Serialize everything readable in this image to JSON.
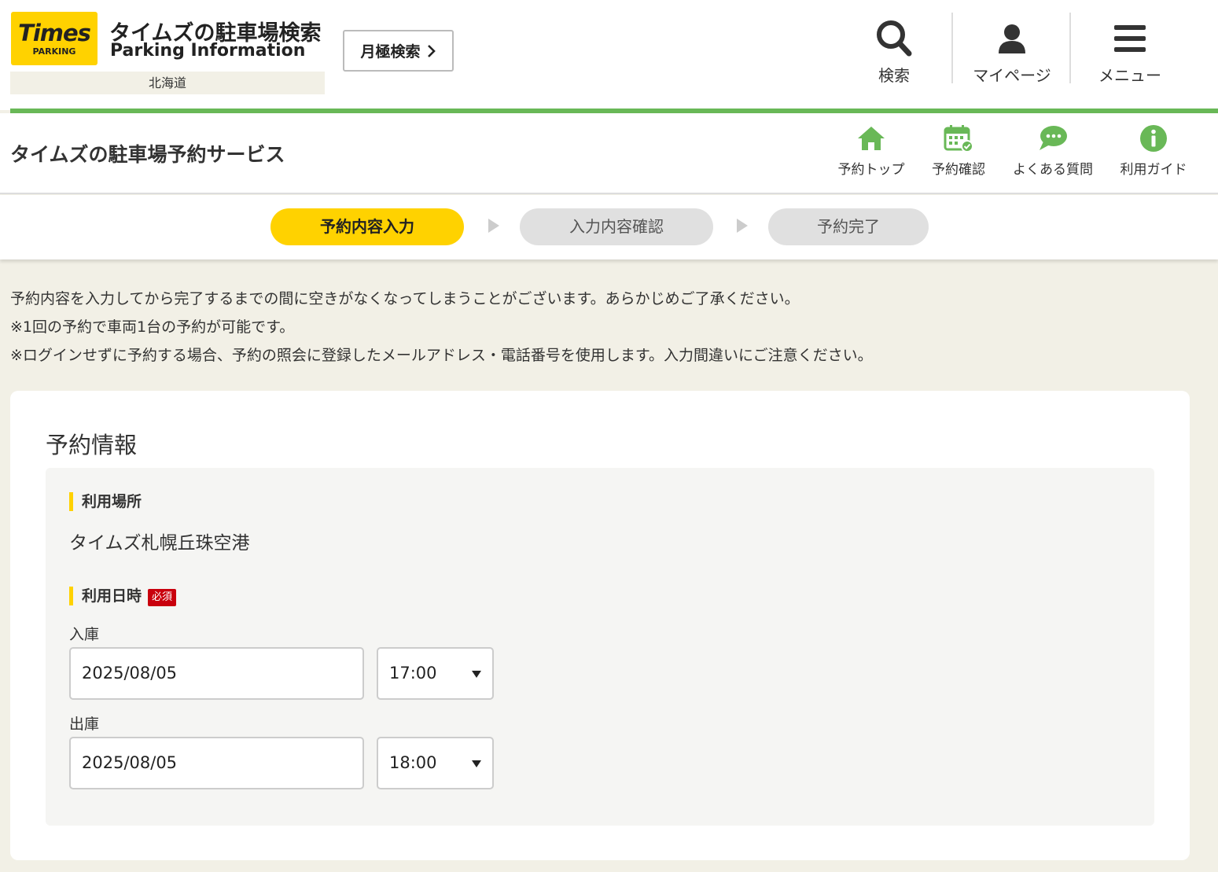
{
  "header": {
    "logo_main": "Times",
    "logo_sub": "PARKING",
    "site_title": "タイムズの駐車場検索",
    "site_subtitle": "Parking Information",
    "region": "北海道",
    "monthly_search": "月極検索",
    "nav": [
      {
        "label": "検索",
        "icon": "search-icon"
      },
      {
        "label": "マイページ",
        "icon": "user-icon"
      },
      {
        "label": "メニュー",
        "icon": "menu-icon"
      }
    ]
  },
  "service": {
    "title": "タイムズの駐車場予約サービス",
    "nav": [
      {
        "label": "予約トップ",
        "icon": "home-icon"
      },
      {
        "label": "予約確認",
        "icon": "calendar-check-icon"
      },
      {
        "label": "よくある質問",
        "icon": "chat-bubble-icon"
      },
      {
        "label": "利用ガイド",
        "icon": "info-icon"
      }
    ]
  },
  "steps": [
    {
      "label": "予約内容入力",
      "active": true
    },
    {
      "label": "入力内容確認",
      "active": false
    },
    {
      "label": "予約完了",
      "active": false
    }
  ],
  "notes": [
    "予約内容を入力してから完了するまでの間に空きがなくなってしまうことがございます。あらかじめご了承ください。",
    "※1回の予約で車両1台の予約が可能です。",
    "※ログインせずに予約する場合、予約の照会に登録したメールアドレス・電話番号を使用します。入力間違いにご注意ください。"
  ],
  "reservation": {
    "title": "予約情報",
    "place_label": "利用場所",
    "place_value": "タイムズ札幌丘珠空港",
    "datetime_label": "利用日時",
    "required_badge": "必須",
    "entry": {
      "label": "入庫",
      "date": "2025/08/05",
      "time": "17:00"
    },
    "exit": {
      "label": "出庫",
      "date": "2025/08/05",
      "time": "18:00"
    }
  },
  "colors": {
    "brand_yellow": "#ffd200",
    "brand_green": "#69b857",
    "required_red": "#c9000d",
    "page_bg": "#f2f0e6"
  }
}
